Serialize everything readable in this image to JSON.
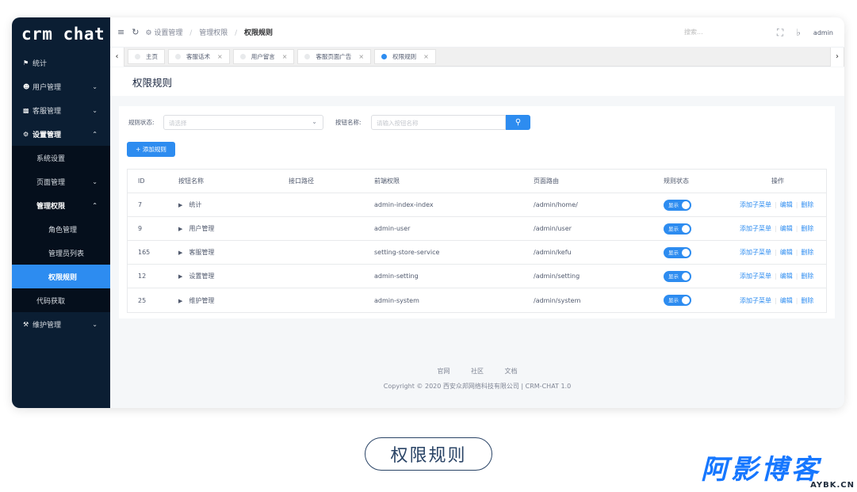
{
  "app": {
    "logo": "crm chat"
  },
  "sidebar": {
    "items": [
      {
        "label": "统计",
        "icon": "home-icon"
      },
      {
        "label": "用户管理",
        "icon": "user-icon"
      },
      {
        "label": "客服管理",
        "icon": "chat-icon"
      },
      {
        "label": "设置管理",
        "icon": "gear-icon"
      },
      {
        "label": "系统设置"
      },
      {
        "label": "页面管理"
      },
      {
        "label": "管理权限"
      },
      {
        "label": "角色管理"
      },
      {
        "label": "管理员列表"
      },
      {
        "label": "权限规则"
      },
      {
        "label": "代码获取"
      },
      {
        "label": "维护管理",
        "icon": "wrench-icon"
      }
    ]
  },
  "header": {
    "breadcrumb": [
      "设置管理",
      "管理权限",
      "权限规则"
    ],
    "search_placeholder": "搜索...",
    "user": "admin"
  },
  "tabs": [
    "主页",
    "客服话术",
    "用户留言",
    "客服页面广告",
    "权限规则"
  ],
  "page": {
    "title": "权限规则"
  },
  "filters": {
    "status_label": "规则状态:",
    "status_placeholder": "请选择",
    "name_label": "按钮名称:",
    "name_placeholder": "请输入按钮名称"
  },
  "add_button": "+ 添加规则",
  "table": {
    "headers": [
      "ID",
      "按钮名称",
      "接口路径",
      "前端权限",
      "页面路由",
      "规则状态",
      "操作"
    ],
    "rows": [
      {
        "id": "7",
        "name": "统计",
        "api": "",
        "fe": "admin-index-index",
        "route": "/admin/home/",
        "status": "显示"
      },
      {
        "id": "9",
        "name": "用户管理",
        "api": "",
        "fe": "admin-user",
        "route": "/admin/user",
        "status": "显示"
      },
      {
        "id": "165",
        "name": "客服管理",
        "api": "",
        "fe": "setting-store-service",
        "route": "/admin/kefu",
        "status": "显示"
      },
      {
        "id": "12",
        "name": "设置管理",
        "api": "",
        "fe": "admin-setting",
        "route": "/admin/setting",
        "status": "显示"
      },
      {
        "id": "25",
        "name": "维护管理",
        "api": "",
        "fe": "admin-system",
        "route": "/admin/system",
        "status": "显示"
      }
    ],
    "ops": {
      "add_child": "添加子菜单",
      "edit": "编辑",
      "delete": "删除"
    }
  },
  "footer": {
    "links": [
      "官网",
      "社区",
      "文档"
    ],
    "copyright": "Copyright © 2020 西安众邦网络科技有限公司 | CRM-CHAT 1.0"
  },
  "caption": "权限规则",
  "watermark": {
    "title": "阿影博客",
    "domain": "AYBK.CN"
  },
  "colors": {
    "accent": "#2d8cf0",
    "sidebar_bg": "#0b1e33",
    "caption_border": "#2a4466",
    "brand_blue": "#1677ff"
  }
}
